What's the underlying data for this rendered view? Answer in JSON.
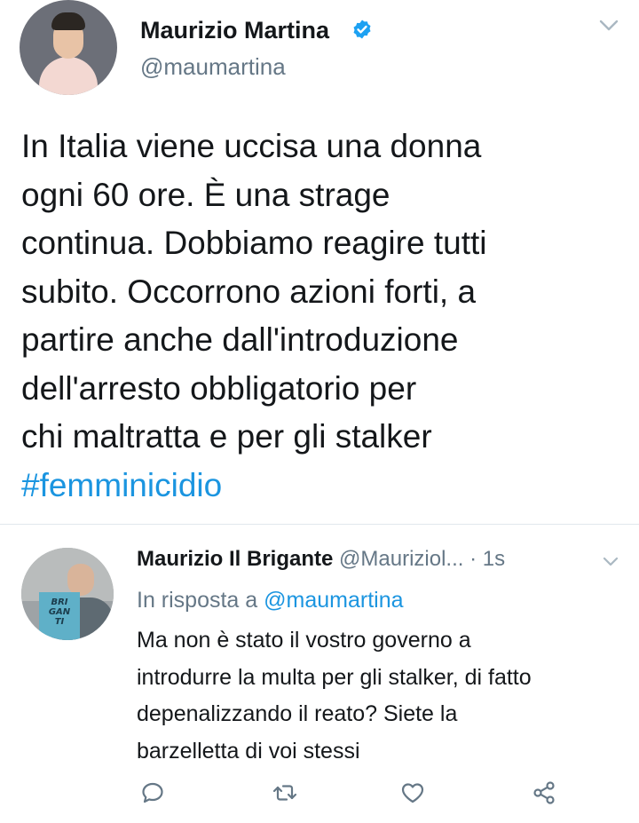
{
  "main_tweet": {
    "author_name": "Maurizio Martina",
    "handle": "@maumartina",
    "text_lines": [
      "In Italia viene uccisa una donna",
      "ogni 60 ore. È una strage",
      "continua. Dobbiamo reagire tutti",
      "subito. Occorrono azioni forti, a",
      "partire anche dall'introduzione",
      "dell'arresto obbligatorio per",
      "chi maltratta e per gli stalker"
    ],
    "hashtag": "#femminicidio",
    "verified": true
  },
  "reply": {
    "author_name": "Maurizio Il Brigante",
    "handle": "@Mauriziol...",
    "time": "· 1s",
    "in_reply_prefix": "In risposta a",
    "in_reply_mention": "@maumartina",
    "text_lines": [
      "Ma non è stato il vostro governo a",
      "introdurre la multa per gli stalker, di fatto",
      "depenalizzando il reato? Siete la",
      "barzelletta di voi stessi"
    ],
    "avatar_book_text": [
      "BRI",
      "GAN",
      "TI"
    ]
  },
  "actions": [
    "reply-icon",
    "retweet-icon",
    "like-icon",
    "share-icon"
  ],
  "colors": {
    "text": "#14171a",
    "secondary": "#657786",
    "link": "#1b95e0",
    "verified": "#1da1f2",
    "icon": "#657786",
    "divider": "#e1e8ed"
  }
}
